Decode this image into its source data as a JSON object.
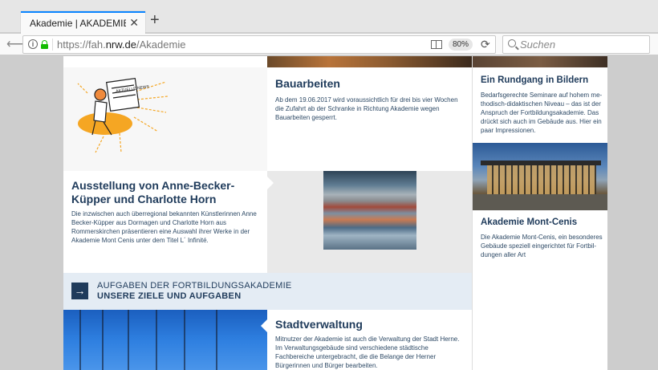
{
  "browser": {
    "tab_title": "Akademie | AKADEMIE MON",
    "url_prefix": "https://fah.",
    "url_domain": "nrw.de",
    "url_path": "/Akademie",
    "zoom": "80%",
    "search_placeholder": "Suchen"
  },
  "cards": {
    "bauarbeiten": {
      "title": "Bauarbeiten",
      "body": "Ab dem 19.06.2017 wird voraussichtlich für drei bis vier Wochen die Zufahrt ab der Schranke in Richtung Akademie wegen Bauarbeiten gesperrt."
    },
    "ausstellung": {
      "title": "Ausstellung von Anne-Becker-Küp­per und Charlotte Horn",
      "body": "Die inzwischen auch überregional bekannten Künstlerinnen Anne Becker-Küpper aus Dormagen und Charlotte Horn aus Rommerskir­chen präsentieren eine Auswahl ihrer Werke in der Akademie Mont Cenis unter dem Titel L´ Infinité."
    },
    "stadtverwaltung": {
      "title": "Stadtverwaltung",
      "body": "Mitnutzer der Akademie ist auch die Verwaltung der Stadt Herne. Im Verwaltungsgebäude sind verschiedene städtische Fachbereiche untergebracht, die die Belange der Herner Bürgerinnen und Bürger bearbeiten."
    },
    "rundgang": {
      "title": "Ein Rundgang in Bildern",
      "body": "Bedarfsgerechte Seminare auf hohem me­thodisch-didaktischen Niveau – das ist der Anspruch der Fortbildungsakademie. Das drückt sich auch im Gebäude aus. Hier ein paar Impressionen."
    },
    "montcenis": {
      "title": "Akademie Mont-Cenis",
      "body": "Die Akademie Mont-Cenis, ein besonderes Gebäude speziell eingerichtet für Fortbil­dungen aller Art"
    }
  },
  "banner": {
    "line1": "AUFGABEN DER FORTBILDUNGSAKADEMIE",
    "line2": "UNSERE ZIELE UND AUFGABEN"
  },
  "illustration": {
    "sign_text": "AKTUELLE NEWS"
  },
  "colors": {
    "accent": "#0a84ff",
    "heading": "#1f3b5b",
    "banner_bg": "#e4ecf4",
    "illus_orange": "#f5a623"
  }
}
